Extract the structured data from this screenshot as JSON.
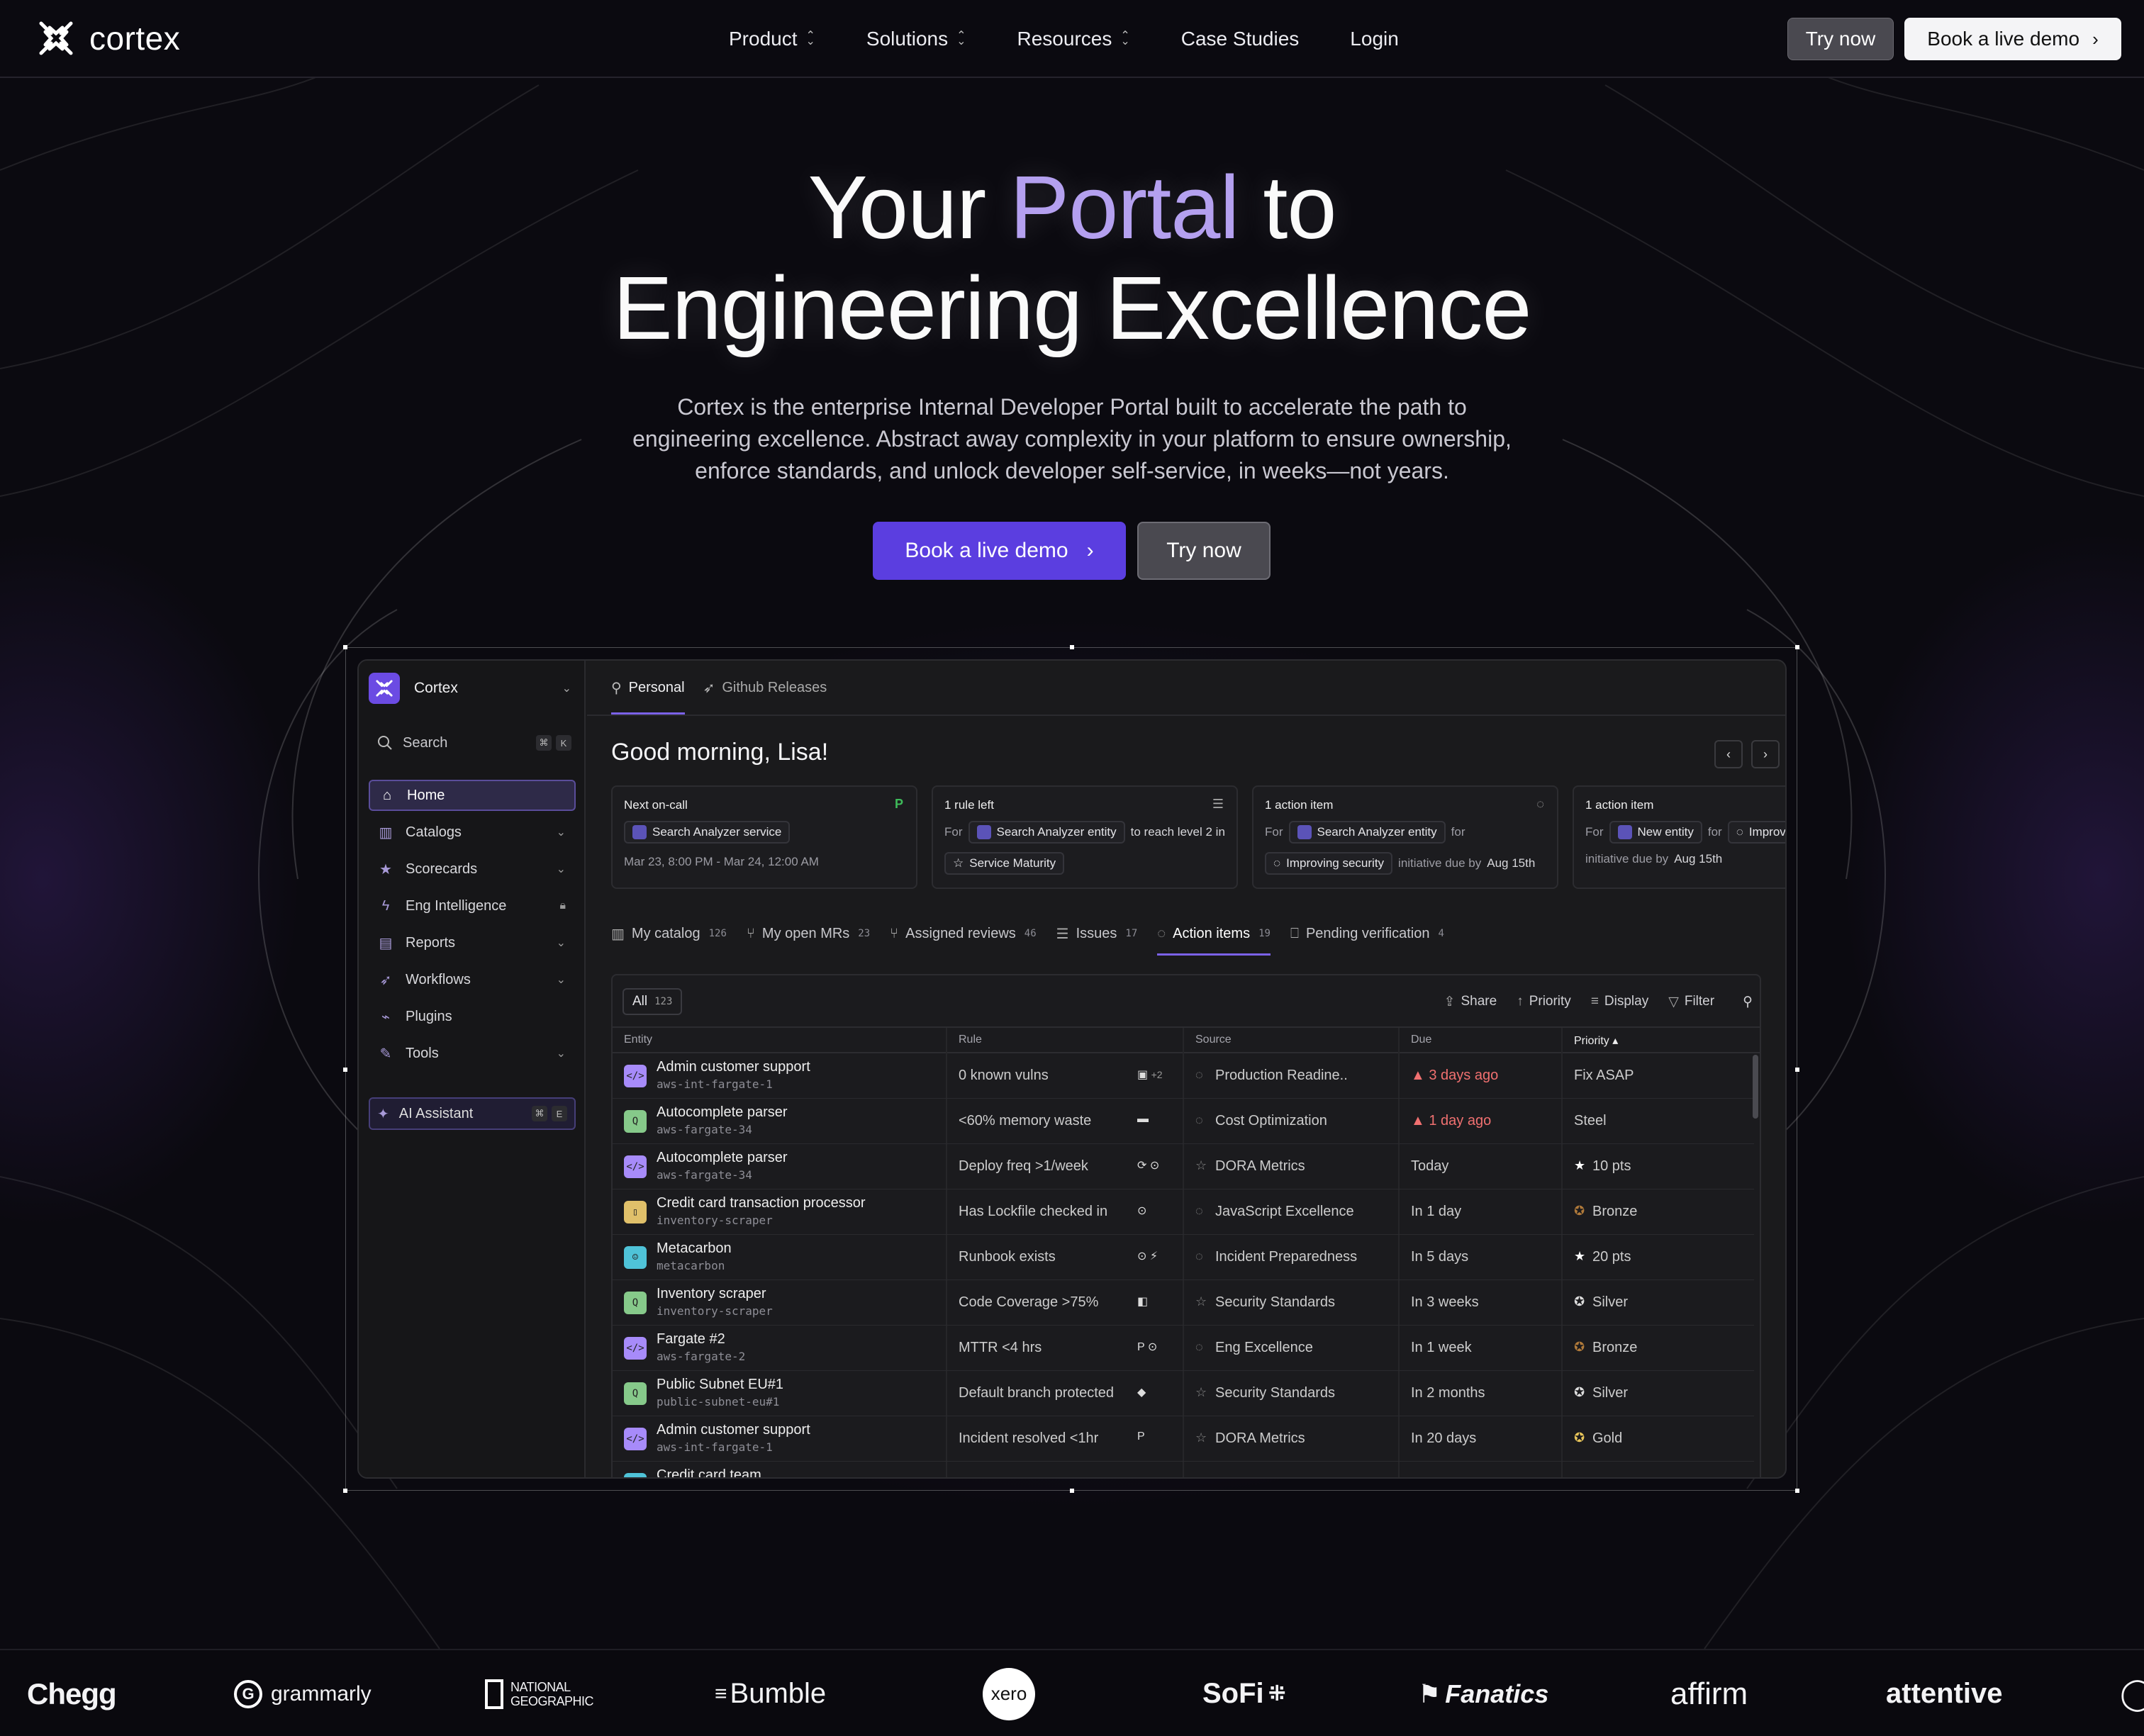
{
  "nav": {
    "brand": "cortex",
    "links": [
      "Product",
      "Solutions",
      "Resources",
      "Case Studies",
      "Login"
    ],
    "try_label": "Try now",
    "demo_label": "Book a live demo"
  },
  "hero": {
    "title_part1": "Your ",
    "title_accent": "Portal",
    "title_part2": " to",
    "title_line2": "Engineering Excellence",
    "subtitle": "Cortex is the enterprise Internal Developer Portal built to accelerate the path to engineering excellence. Abstract away complexity in your platform to ensure ownership, enforce standards, and unlock developer self-service, in weeks—not years.",
    "demo_label": "Book a live demo",
    "try_label": "Try now"
  },
  "app": {
    "org": "Cortex",
    "search": {
      "label": "Search",
      "kbd1": "⌘",
      "kbd2": "K"
    },
    "sidebar": [
      {
        "label": "Home",
        "icon": "home-icon",
        "active": true
      },
      {
        "label": "Catalogs",
        "icon": "book-icon",
        "chev": true
      },
      {
        "label": "Scorecards",
        "icon": "star-icon",
        "chev": true
      },
      {
        "label": "Eng Intelligence",
        "icon": "bolt-icon",
        "lock": true
      },
      {
        "label": "Reports",
        "icon": "chart-icon",
        "chev": true
      },
      {
        "label": "Workflows",
        "icon": "rocket-icon",
        "chev": true
      },
      {
        "label": "Plugins",
        "icon": "plug-icon"
      },
      {
        "label": "Tools",
        "icon": "wrench-icon",
        "chev": true
      }
    ],
    "ai": {
      "label": "AI Assistant",
      "kbd1": "⌘",
      "kbd2": "E"
    },
    "top_tabs": [
      "Personal",
      "Github Releases"
    ],
    "greeting": "Good morning, Lisa!",
    "cards": [
      {
        "title": "Next on-call",
        "chip": "Search Analyzer service",
        "line": "Mar 23, 8:00 PM - Mar 24, 12:00 AM"
      },
      {
        "title": "1 rule left",
        "for": "For",
        "chip": "Search Analyzer entity",
        "tail": "to reach level 2 in",
        "chip2": "Service Maturity"
      },
      {
        "title": "1 action item",
        "for": "For",
        "chip": "Search Analyzer entity",
        "tail": "for",
        "chip2": "Improving security",
        "tail2": "initiative due by",
        "due": "Aug 15th"
      },
      {
        "title": "1 action item",
        "for": "For",
        "chip": "New entity",
        "tail": "for",
        "chip2": "Improv",
        "tail2": "initiative due by",
        "due": "Aug 15th"
      }
    ],
    "mid_tabs": [
      {
        "label": "My catalog",
        "count": "126"
      },
      {
        "label": "My open MRs",
        "count": "23"
      },
      {
        "label": "Assigned reviews",
        "count": "46"
      },
      {
        "label": "Issues",
        "count": "17"
      },
      {
        "label": "Action items",
        "count": "19",
        "active": true
      },
      {
        "label": "Pending verification",
        "count": "4"
      }
    ],
    "table": {
      "all_label": "All",
      "all_count": "123",
      "actions": [
        "Share",
        "Priority",
        "Display",
        "Filter"
      ],
      "columns": [
        "Entity",
        "Rule",
        "Source",
        "Due",
        "Priority"
      ],
      "rows": [
        {
          "name": "Admin customer support",
          "sub": "aws-int-fargate-1",
          "rule": "0 known vulns",
          "rule_extra": "+2",
          "source": "Production Readine..",
          "due": "3 days ago",
          "due_red": true,
          "priority": "Fix ASAP",
          "color": "#a78bfa",
          "glyph": "</>"
        },
        {
          "name": "Autocomplete parser",
          "sub": "aws-fargate-34",
          "rule": "<60% memory waste",
          "source": "Cost Optimization",
          "due": "1 day ago",
          "due_red": true,
          "priority": "Steel",
          "color": "#86c98a",
          "glyph": "Q"
        },
        {
          "name": "Autocomplete parser",
          "sub": "aws-fargate-34",
          "rule": "Deploy freq >1/week",
          "source": "DORA Metrics",
          "due": "Today",
          "priority": "10 pts",
          "color": "#a78bfa",
          "glyph": "</>"
        },
        {
          "name": "Credit card transaction processor",
          "sub": "inventory-scraper",
          "rule": "Has Lockfile checked in",
          "source": "JavaScript Excellence",
          "due": "In 1 day",
          "priority": "Bronze",
          "color": "#e0c06a",
          "glyph": "▯"
        },
        {
          "name": "Metacarbon",
          "sub": "metacarbon",
          "rule": "Runbook exists",
          "source": "Incident Preparedness",
          "due": "In 5 days",
          "priority": "20 pts",
          "color": "#4fc3d8",
          "glyph": "☺"
        },
        {
          "name": "Inventory scraper",
          "sub": "inventory-scraper",
          "rule": "Code Coverage >75%",
          "source": "Security Standards",
          "due": "In 3 weeks",
          "priority": "Silver",
          "color": "#86c98a",
          "glyph": "Q"
        },
        {
          "name": "Fargate #2",
          "sub": "aws-fargate-2",
          "rule": "MTTR <4 hrs",
          "source": "Eng Excellence",
          "due": "In 1 week",
          "priority": "Bronze",
          "color": "#a78bfa",
          "glyph": "</>"
        },
        {
          "name": "Public Subnet EU#1",
          "sub": "public-subnet-eu#1",
          "rule": "Default branch protected",
          "source": "Security Standards",
          "due": "In 2 months",
          "priority": "Silver",
          "color": "#86c98a",
          "glyph": "Q"
        },
        {
          "name": "Admin customer support",
          "sub": "aws-int-fargate-1",
          "rule": "Incident resolved <1hr",
          "source": "DORA Metrics",
          "due": "In 20 days",
          "priority": "Gold",
          "color": "#a78bfa",
          "glyph": "</>"
        },
        {
          "name": "Credit card team",
          "sub": "",
          "rule": "",
          "source": "",
          "due": "",
          "priority": "",
          "color": "#4fc3d8",
          "glyph": "☺"
        }
      ]
    }
  },
  "logos": [
    "Chegg",
    "grammarly",
    "NATIONAL GEOGRAPHIC",
    "Bumble",
    "xero",
    "SoFi",
    "Fanatics",
    "affirm",
    "attentive"
  ]
}
